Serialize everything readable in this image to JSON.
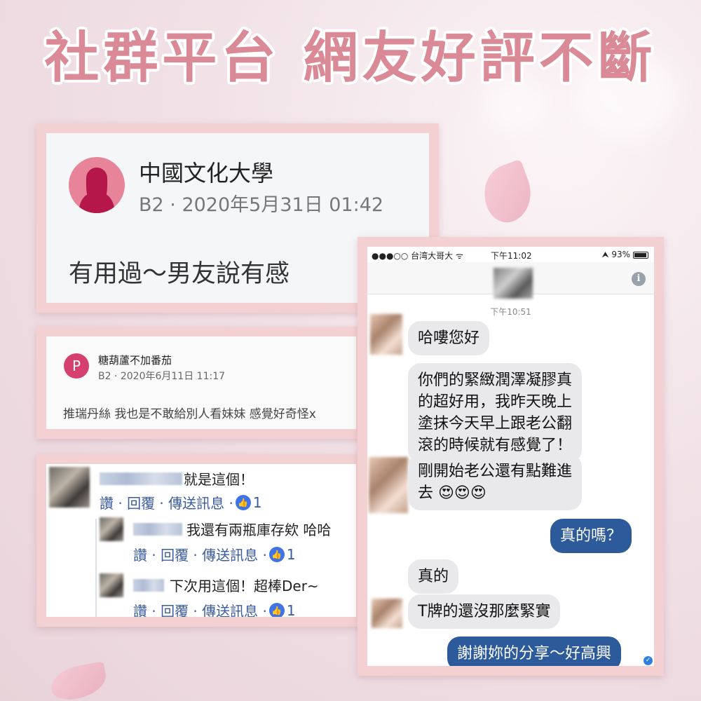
{
  "headline": "社群平台 網友好評不斷",
  "post1": {
    "name": "中國文化大學",
    "meta": "B2 · 2020年5月31日 01:42",
    "body": "有用過～男友說有感"
  },
  "post2": {
    "avatar_letter": "P",
    "name": "糖葫蘆不加番茄",
    "meta": "B2 · 2020年6月11日 11:17",
    "body": "推瑞丹絲 我也是不敢給別人看妹妹 感覺好奇怪x"
  },
  "comments": [
    {
      "text": "就是這個！",
      "actions": "讚 · 回覆 · 傳送訊息 ·",
      "likes": "1"
    },
    {
      "text": "我還有兩瓶庫存欸 哈哈",
      "actions": "讚 · 回覆 · 傳送訊息 ·",
      "likes": "1"
    },
    {
      "text": "下次用這個！超棒Der~",
      "actions": "讚 · 回覆 · 傳送訊息 ·",
      "likes": "1"
    }
  ],
  "phone": {
    "carrier": "●●●○○ 台湾大哥大 ᯤ",
    "time": "下午11:02",
    "battery": "⮝ 93%",
    "chat_time": "下午10:51",
    "messages": [
      {
        "dir": "in",
        "text": "哈嘍您好"
      },
      {
        "dir": "in",
        "text": "你們的緊緻潤澤凝膠真\n的超好用，我昨天晚上\n塗抹今天早上跟老公翻\n滾的時候就有感覺了！"
      },
      {
        "dir": "in",
        "text": "剛開始老公還有點難進\n去 😍😍😍"
      },
      {
        "dir": "out",
        "text": "真的嗎？"
      },
      {
        "dir": "in",
        "text": "真的"
      },
      {
        "dir": "in",
        "text": "T牌的還沒那麼緊實"
      },
      {
        "dir": "out",
        "text": "謝謝妳的分享～好高興"
      }
    ]
  },
  "colors": {
    "headline": "#d98a96",
    "frame": "#f3d1d3",
    "outgoing_bubble": "#2d5a9b",
    "incoming_bubble": "#e9e9eb",
    "fb_link": "#3b5ba0"
  },
  "icons": [
    "person-silhouette-icon",
    "info-icon",
    "like-thumb-icon",
    "wifi-icon",
    "battery-icon",
    "read-receipt-icon"
  ]
}
